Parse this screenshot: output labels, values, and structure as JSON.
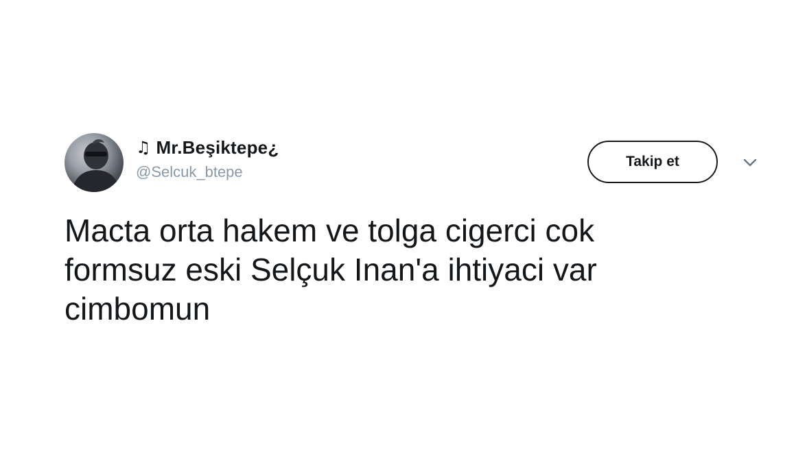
{
  "author": {
    "prefix_symbol": "♫",
    "display_name": "Mr.Beşiktepe¿",
    "handle": "@Selcuk_btepe"
  },
  "actions": {
    "follow_label": "Takip et"
  },
  "icons": {
    "author_prefix": "music-note-icon",
    "menu": "chevron-down-icon"
  },
  "tweet": {
    "lines": [
      "Macta orta hakem ve tolga cigerci cok",
      "formsuz eski Selçuk Inan'a ihtiyaci var",
      "cimbomun"
    ]
  },
  "colors": {
    "text": "#14171a",
    "handle": "#8899a6",
    "background": "#ffffff"
  }
}
